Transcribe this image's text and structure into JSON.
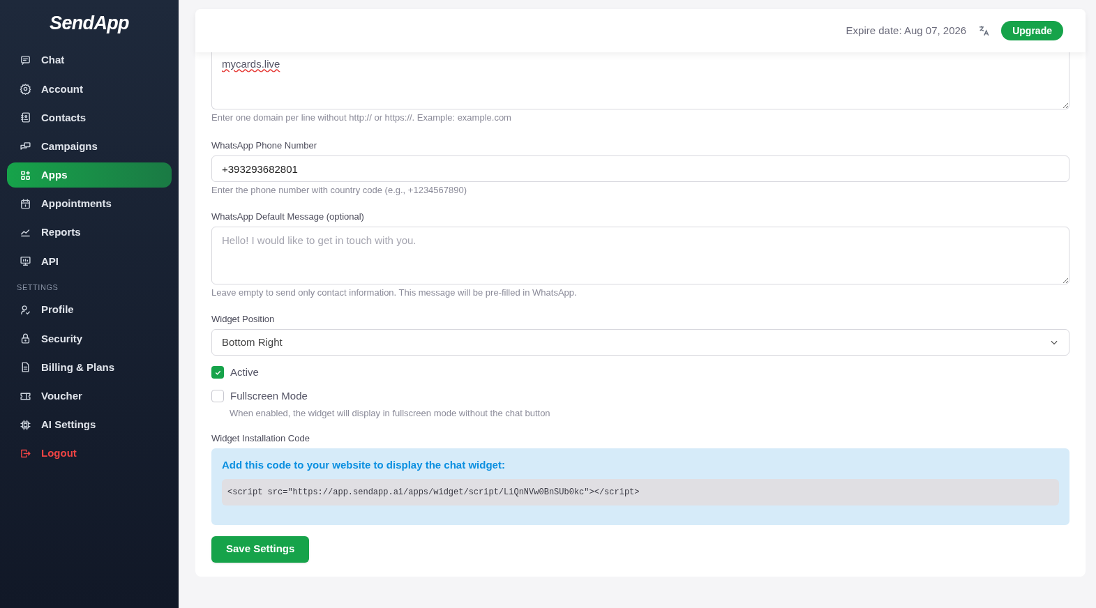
{
  "sidebar": {
    "logo": "SendApp",
    "items": [
      {
        "kind": "link",
        "label": "Chat",
        "selected": false
      },
      {
        "kind": "link",
        "label": "Account",
        "selected": false
      },
      {
        "kind": "link",
        "label": "Contacts",
        "selected": false
      },
      {
        "kind": "link",
        "label": "Campaigns",
        "selected": false
      },
      {
        "kind": "link",
        "label": "Apps",
        "selected": true
      },
      {
        "kind": "link",
        "label": "Appointments",
        "selected": false
      },
      {
        "kind": "link",
        "label": "Reports",
        "selected": false
      },
      {
        "kind": "link",
        "label": "API",
        "selected": false
      },
      {
        "kind": "heading",
        "label": "SETTINGS"
      },
      {
        "kind": "link",
        "label": "Profile",
        "selected": false
      },
      {
        "kind": "link",
        "label": "Security",
        "selected": false
      },
      {
        "kind": "link",
        "label": "Billing & Plans",
        "selected": false
      },
      {
        "kind": "link",
        "label": "Voucher",
        "selected": false
      },
      {
        "kind": "link",
        "label": "AI Settings",
        "selected": false
      },
      {
        "kind": "danger",
        "label": "Logout",
        "selected": false
      }
    ]
  },
  "header": {
    "expire": "Expire date: Aug 07, 2026",
    "upgrade": "Upgrade"
  },
  "form": {
    "domains": {
      "value": "mycards.live",
      "help": "Enter one domain per line without http:// or https://. Example: example.com"
    },
    "phone": {
      "label": "WhatsApp Phone Number",
      "value": "+393293682801",
      "help": "Enter the phone number with country code (e.g., +1234567890)"
    },
    "message": {
      "label": "WhatsApp Default Message (optional)",
      "placeholder": "Hello! I would like to get in touch with you.",
      "help": "Leave empty to send only contact information. This message will be pre-filled in WhatsApp."
    },
    "position": {
      "label": "Widget Position",
      "value": "Bottom Right"
    },
    "checkboxes": [
      {
        "label": "Active",
        "checked": true
      },
      {
        "label": "Fullscreen Mode",
        "checked": false,
        "help": "When enabled, the widget will display in fullscreen mode without the chat button"
      }
    ],
    "code": {
      "label": "Widget Installation Code",
      "title": "Add this code to your website to display the chat widget:",
      "snippet": "<script src=\"https://app.sendapp.ai/apps/widget/script/LiQnNVw0BnSUb0kc\"></script>"
    },
    "save": "Save Settings"
  }
}
